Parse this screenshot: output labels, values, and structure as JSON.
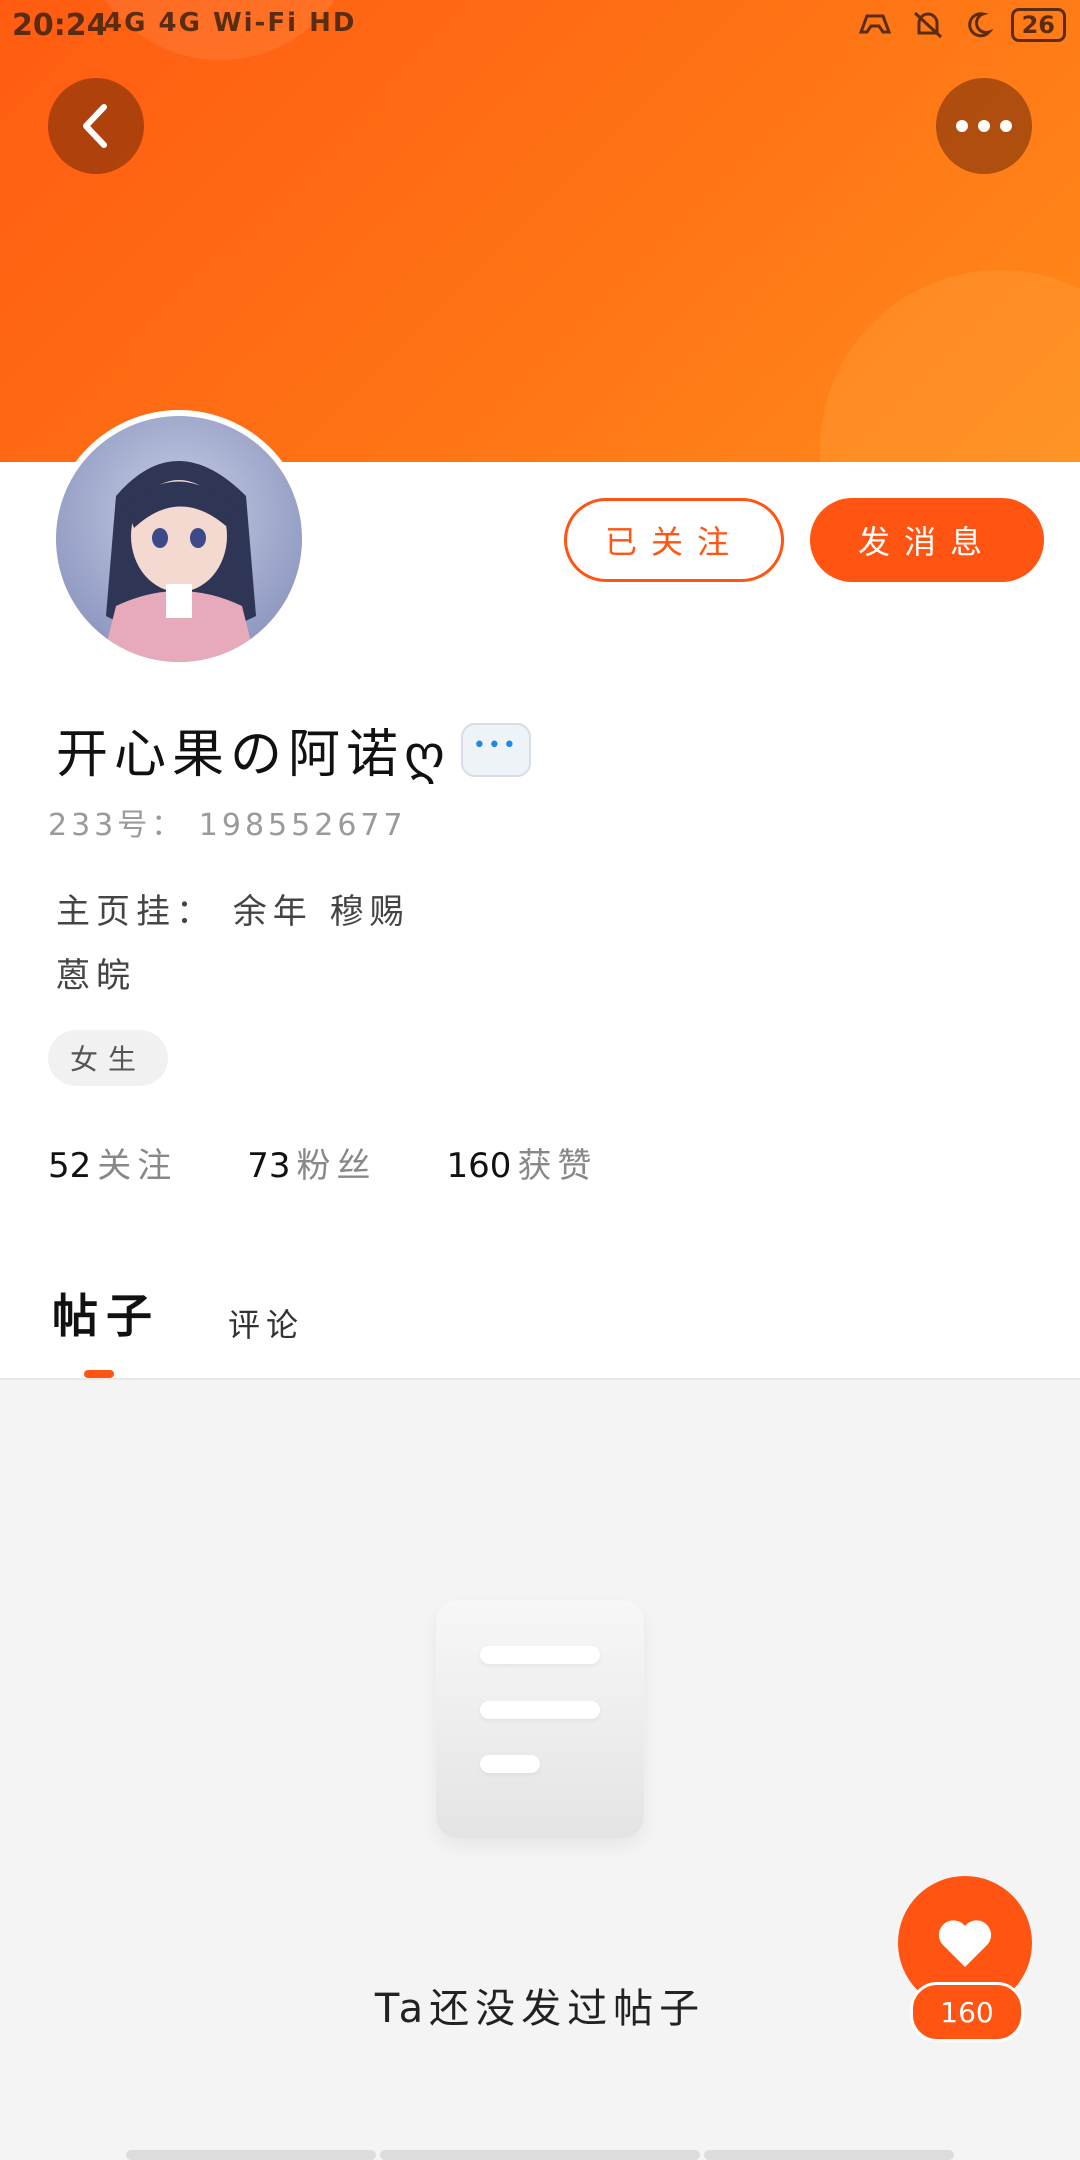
{
  "status_bar": {
    "time": "20:24",
    "left_icons": "4G 4G Wi‑Fi HD",
    "battery": "26"
  },
  "header": {
    "back_icon": "chevron-left-icon",
    "more_icon": "more-dots-icon"
  },
  "profile": {
    "username": "开心果の阿诺ღ",
    "uid": "233号： 198552677",
    "bio_line1": "主页挂： 余年 穆赐",
    "bio_line2": "蒽皖",
    "gender_tag": "女生",
    "followed_label": "已关注",
    "message_label": "发消息",
    "bubble_dots": "•••"
  },
  "stats": [
    {
      "num": "52",
      "label": "关注"
    },
    {
      "num": "73",
      "label": "粉丝"
    },
    {
      "num": "160",
      "label": "获赞"
    }
  ],
  "tabs": {
    "active": "帖子",
    "other": "评论"
  },
  "empty_state": {
    "text": "Ta还没发过帖子"
  },
  "fab": {
    "count": "160"
  },
  "colors": {
    "accent": "#ff5412",
    "banner_start": "#ff5c12",
    "banner_end": "#ff8a1a"
  }
}
